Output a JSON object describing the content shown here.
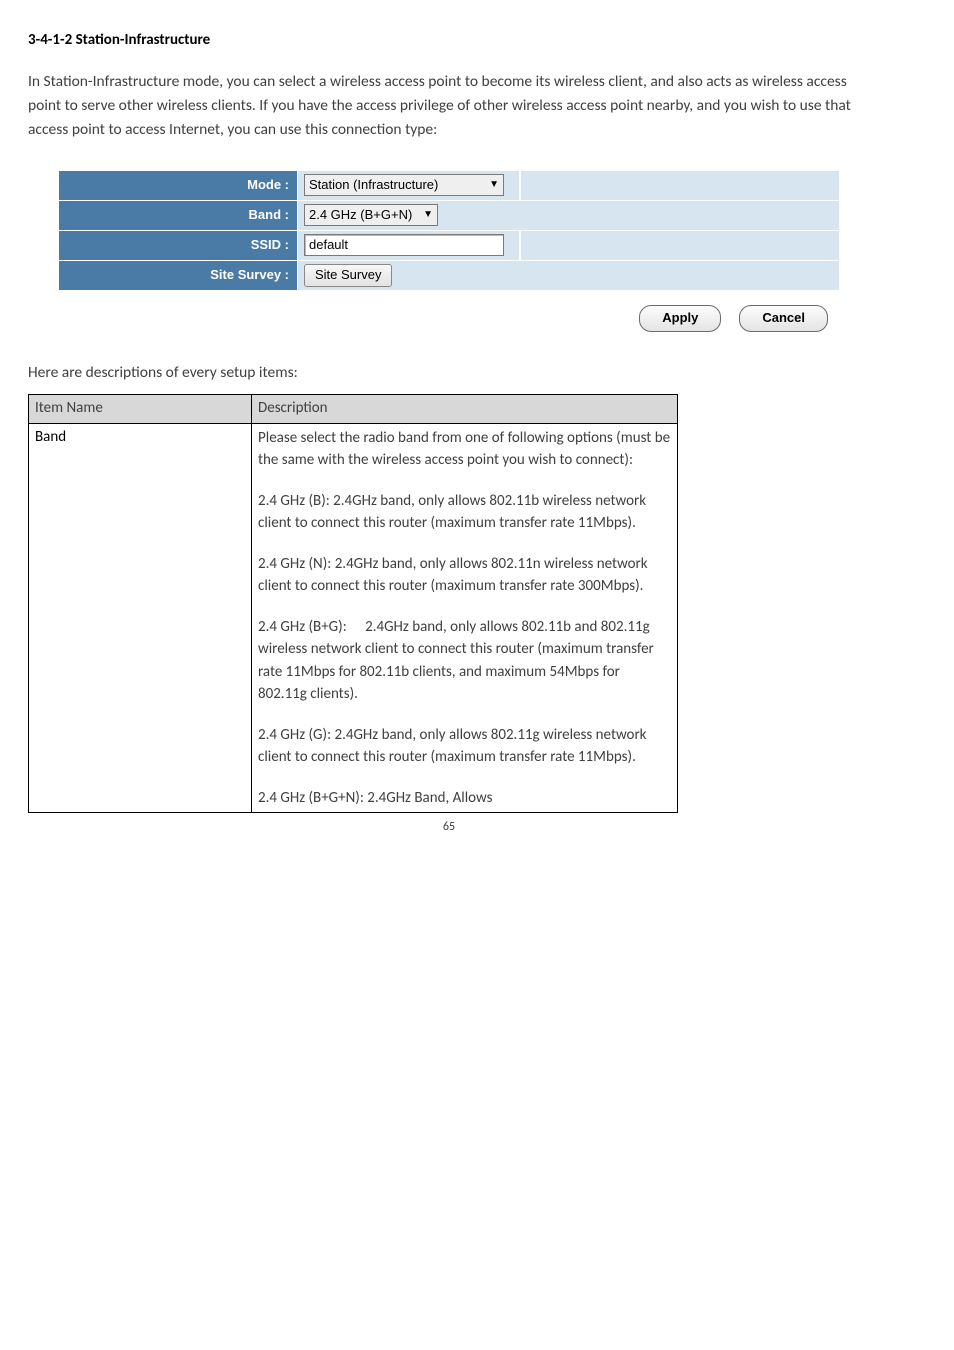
{
  "heading": "3-4-1-2 Station-Infrastructure",
  "intro": "In Station-Infrastructure mode, you can select a wireless access point to become its wireless client, and also acts as wireless access point to serve other wireless clients. If you have the access privilege of other wireless access point nearby, and you wish to use that access point to access Internet, you can use this connection type:",
  "settings": {
    "mode_label": "Mode :",
    "mode_value": "Station (Infrastructure)",
    "band_label": "Band :",
    "band_value": "2.4 GHz (B+G+N)",
    "ssid_label": "SSID :",
    "ssid_value": "default",
    "survey_label": "Site Survey :",
    "survey_button": "Site Survey"
  },
  "buttons": {
    "apply": "Apply",
    "cancel": "Cancel"
  },
  "desc_intro": "Here are descriptions of every setup items:",
  "table": {
    "h_item": "Item Name",
    "h_desc": "Description",
    "item_band": "Band",
    "band_p1": "Please select the radio band from one of following options (must be the same with the wireless access point you wish to connect):",
    "band_p2": "2.4 GHz (B): 2.4GHz band, only allows 802.11b wireless network client to connect this router (maximum transfer rate 11Mbps).",
    "band_p3": "2.4 GHz (N): 2.4GHz band, only allows 802.11n wireless network client to connect this router (maximum transfer rate 300Mbps).",
    "band_p4": "2.4 GHz (B+G):  2.4GHz band, only allows 802.11b and 802.11g wireless network client to connect this router (maximum transfer rate 11Mbps for 802.11b clients, and maximum 54Mbps for 802.11g clients).",
    "band_p5": "2.4 GHz (G): 2.4GHz band, only allows 802.11g wireless network client to connect this router (maximum transfer rate 11Mbps).",
    "band_p6": "2.4 GHz (B+G+N): 2.4GHz Band, Allows"
  },
  "page_number": "65"
}
